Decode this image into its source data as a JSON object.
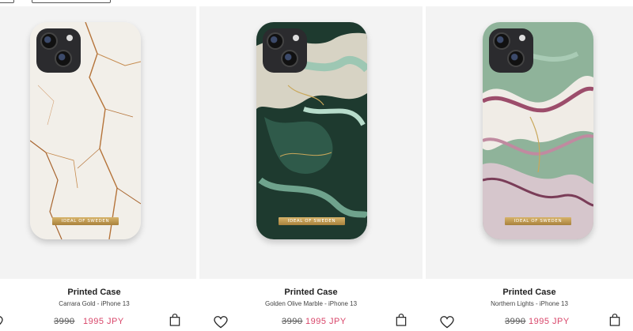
{
  "products": [
    {
      "title": "Printed Case",
      "subtitle": "Carrara Gold - iPhone 13",
      "old_price": "3990",
      "new_price": "1995 JPY",
      "brand_plate": "IDEAL OF SWEDEN",
      "theme": "carrara-gold",
      "colors": {
        "base": "#f2efe9",
        "vein": "#b5743a"
      }
    },
    {
      "title": "Printed Case",
      "subtitle": "Golden Olive Marble - iPhone 13",
      "old_price": "3990",
      "new_price": "1995 JPY",
      "brand_plate": "IDEAL OF SWEDEN",
      "theme": "golden-olive-marble",
      "colors": {
        "base": "#1e3a2f",
        "vein": "#6fa38d"
      }
    },
    {
      "title": "Printed Case",
      "subtitle": "Northern Lights - iPhone 13",
      "old_price": "3990",
      "new_price": "1995 JPY",
      "brand_plate": "IDEAL OF SWEDEN",
      "theme": "northern-lights",
      "colors": {
        "base": "#8fb39a",
        "vein": "#9c4d6b"
      }
    }
  ],
  "icons": {
    "wishlist": "heart-icon",
    "cart": "shopping-bag-icon"
  },
  "accent": {
    "sale_price": "#d9466a"
  }
}
